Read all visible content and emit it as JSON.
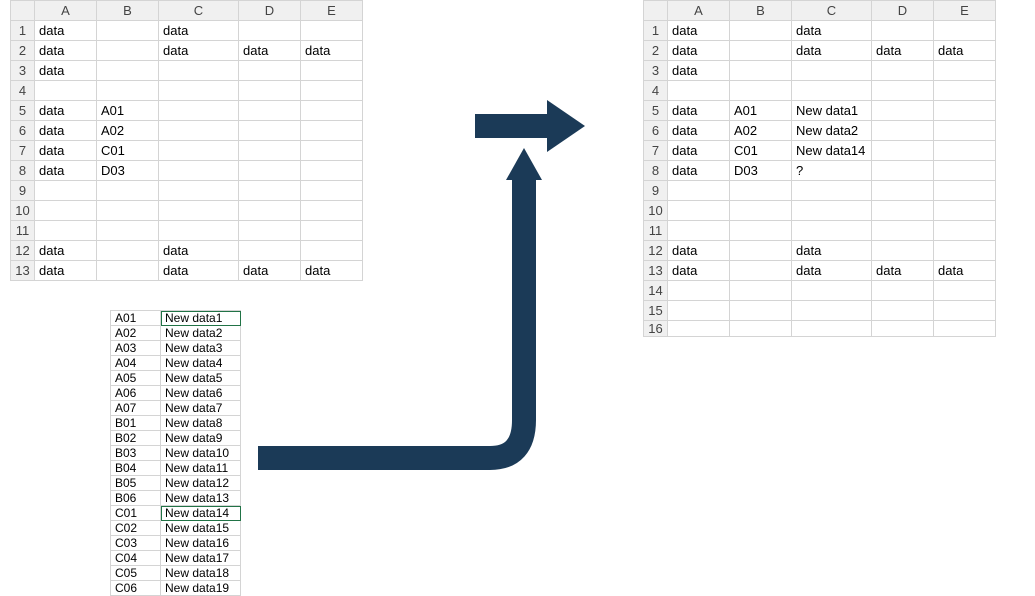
{
  "colors": {
    "arrow": "#1b3a57"
  },
  "columns": [
    "A",
    "B",
    "C",
    "D",
    "E"
  ],
  "sheet_left": {
    "rows": [
      {
        "n": "1",
        "A": "data",
        "B": "",
        "C": "data",
        "D": "",
        "E": ""
      },
      {
        "n": "2",
        "A": "data",
        "B": "",
        "C": "data",
        "D": "data",
        "E": "data"
      },
      {
        "n": "3",
        "A": "data",
        "B": "",
        "C": "",
        "D": "",
        "E": ""
      },
      {
        "n": "4",
        "A": "",
        "B": "",
        "C": "",
        "D": "",
        "E": ""
      },
      {
        "n": "5",
        "A": "data",
        "B": "A01",
        "C": "",
        "D": "",
        "E": ""
      },
      {
        "n": "6",
        "A": "data",
        "B": "A02",
        "C": "",
        "D": "",
        "E": ""
      },
      {
        "n": "7",
        "A": "data",
        "B": "C01",
        "C": "",
        "D": "",
        "E": ""
      },
      {
        "n": "8",
        "A": "data",
        "B": "D03",
        "C": "",
        "D": "",
        "E": ""
      },
      {
        "n": "9",
        "A": "",
        "B": "",
        "C": "",
        "D": "",
        "E": ""
      },
      {
        "n": "10",
        "A": "",
        "B": "",
        "C": "",
        "D": "",
        "E": ""
      },
      {
        "n": "11",
        "A": "",
        "B": "",
        "C": "",
        "D": "",
        "E": ""
      },
      {
        "n": "12",
        "A": "data",
        "B": "",
        "C": "data",
        "D": "",
        "E": ""
      },
      {
        "n": "13",
        "A": "data",
        "B": "",
        "C": "data",
        "D": "data",
        "E": "data"
      }
    ]
  },
  "sheet_right": {
    "rows": [
      {
        "n": "1",
        "A": "data",
        "B": "",
        "C": "data",
        "D": "",
        "E": ""
      },
      {
        "n": "2",
        "A": "data",
        "B": "",
        "C": "data",
        "D": "data",
        "E": "data"
      },
      {
        "n": "3",
        "A": "data",
        "B": "",
        "C": "",
        "D": "",
        "E": ""
      },
      {
        "n": "4",
        "A": "",
        "B": "",
        "C": "",
        "D": "",
        "E": ""
      },
      {
        "n": "5",
        "A": "data",
        "B": "A01",
        "C": "New data1",
        "D": "",
        "E": ""
      },
      {
        "n": "6",
        "A": "data",
        "B": "A02",
        "C": "New data2",
        "D": "",
        "E": ""
      },
      {
        "n": "7",
        "A": "data",
        "B": "C01",
        "C": "New data14",
        "D": "",
        "E": ""
      },
      {
        "n": "8",
        "A": "data",
        "B": "D03",
        "C": "?",
        "D": "",
        "E": ""
      },
      {
        "n": "9",
        "A": "",
        "B": "",
        "C": "",
        "D": "",
        "E": ""
      },
      {
        "n": "10",
        "A": "",
        "B": "",
        "C": "",
        "D": "",
        "E": ""
      },
      {
        "n": "11",
        "A": "",
        "B": "",
        "C": "",
        "D": "",
        "E": ""
      },
      {
        "n": "12",
        "A": "data",
        "B": "",
        "C": "data",
        "D": "",
        "E": ""
      },
      {
        "n": "13",
        "A": "data",
        "B": "",
        "C": "data",
        "D": "data",
        "E": "data"
      },
      {
        "n": "14",
        "A": "",
        "B": "",
        "C": "",
        "D": "",
        "E": ""
      },
      {
        "n": "15",
        "A": "",
        "B": "",
        "C": "",
        "D": "",
        "E": ""
      },
      {
        "n": "16",
        "A": "",
        "B": "",
        "C": "",
        "D": "",
        "E": ""
      }
    ]
  },
  "lookup_table": {
    "rows": [
      {
        "k": "A01",
        "v": "New data1"
      },
      {
        "k": "A02",
        "v": "New data2"
      },
      {
        "k": "A03",
        "v": "New data3"
      },
      {
        "k": "A04",
        "v": "New data4"
      },
      {
        "k": "A05",
        "v": "New data5"
      },
      {
        "k": "A06",
        "v": "New data6"
      },
      {
        "k": "A07",
        "v": "New data7"
      },
      {
        "k": "B01",
        "v": "New data8"
      },
      {
        "k": "B02",
        "v": "New data9"
      },
      {
        "k": "B03",
        "v": "New data10"
      },
      {
        "k": "B04",
        "v": "New data11"
      },
      {
        "k": "B05",
        "v": "New data12"
      },
      {
        "k": "B06",
        "v": "New data13"
      },
      {
        "k": "C01",
        "v": "New data14"
      },
      {
        "k": "C02",
        "v": "New data15"
      },
      {
        "k": "C03",
        "v": "New data16"
      },
      {
        "k": "C04",
        "v": "New data17"
      },
      {
        "k": "C05",
        "v": "New data18"
      },
      {
        "k": "C06",
        "v": "New data19"
      }
    ],
    "highlight_index": 13
  }
}
